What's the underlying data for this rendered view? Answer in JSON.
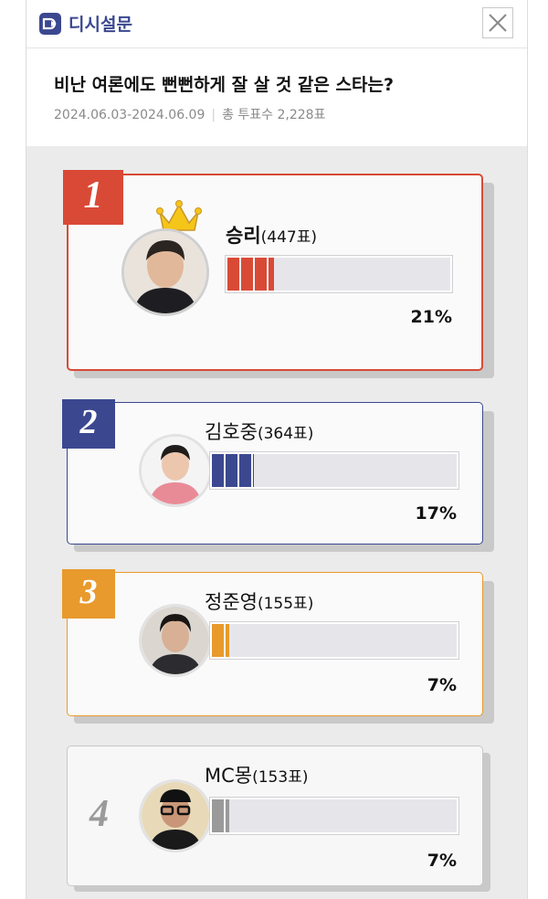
{
  "header": {
    "title": "디시설문"
  },
  "poll": {
    "question": "비난 여론에도 뻔뻔하게 잘 살 것 같은 스타는?",
    "period": "2024.06.03-2024.06.09",
    "total_votes": "총 투표수 2,228표"
  },
  "results": [
    {
      "rank": "1",
      "name": "승리",
      "votes": "(447표)",
      "percent_label": "21%",
      "percent": 21,
      "accent": "#d94a36",
      "winner": true
    },
    {
      "rank": "2",
      "name": "김호중",
      "votes": "(364표)",
      "percent_label": "17%",
      "percent": 17,
      "accent": "#3b4890",
      "winner": false
    },
    {
      "rank": "3",
      "name": "정준영",
      "votes": "(155표)",
      "percent_label": "7%",
      "percent": 7,
      "accent": "#e89a2c",
      "winner": false
    },
    {
      "rank": "4",
      "name": "MC몽",
      "votes": "(153표)",
      "percent_label": "7%",
      "percent": 7,
      "accent": "#9a9a9a",
      "winner": false
    }
  ]
}
